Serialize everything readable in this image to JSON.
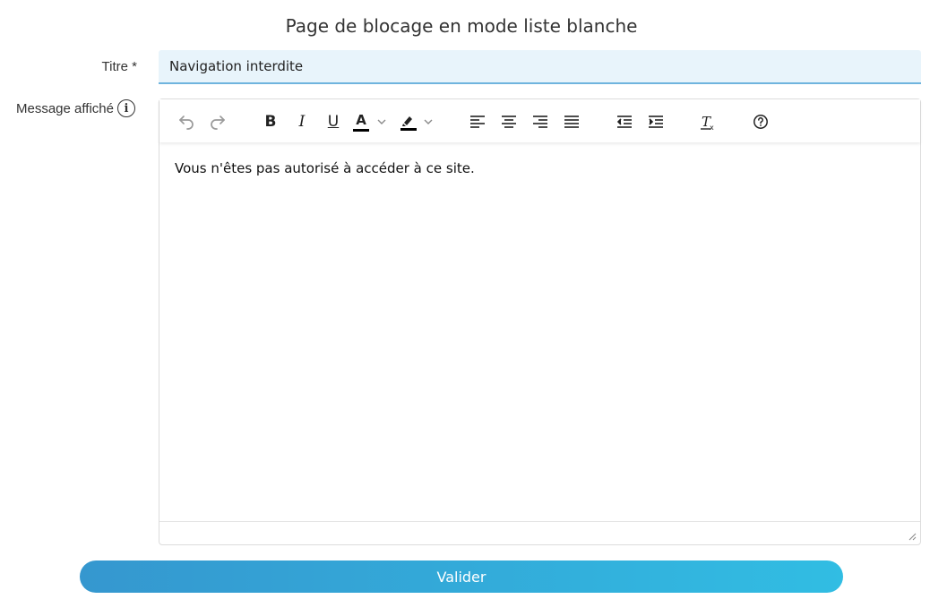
{
  "page": {
    "title": "Page de blocage en mode liste blanche"
  },
  "form": {
    "title_label": "Titre *",
    "title_value": "Navigation interdite",
    "message_label": "Message affiché",
    "message_content": "Vous n'êtes pas autorisé à accéder à ce site."
  },
  "toolbar": {
    "buttons": [
      {
        "name": "undo",
        "icon": "undo-icon",
        "disabled": true
      },
      {
        "name": "redo",
        "icon": "redo-icon",
        "disabled": true
      },
      {
        "name": "bold",
        "icon": "bold-icon",
        "glyph": "B"
      },
      {
        "name": "italic",
        "icon": "italic-icon",
        "glyph": "I"
      },
      {
        "name": "underline",
        "icon": "underline-icon",
        "glyph": "U"
      },
      {
        "name": "text-color",
        "icon": "text-color-icon",
        "glyph": "A"
      },
      {
        "name": "highlight-color",
        "icon": "highlight-icon"
      },
      {
        "name": "align-left",
        "icon": "align-left-icon"
      },
      {
        "name": "align-center",
        "icon": "align-center-icon"
      },
      {
        "name": "align-right",
        "icon": "align-right-icon"
      },
      {
        "name": "justify",
        "icon": "justify-icon"
      },
      {
        "name": "outdent",
        "icon": "outdent-icon"
      },
      {
        "name": "indent",
        "icon": "indent-icon"
      },
      {
        "name": "clear-format",
        "icon": "clear-format-icon"
      },
      {
        "name": "help",
        "icon": "help-icon"
      }
    ]
  },
  "actions": {
    "submit_label": "Valider"
  },
  "colors": {
    "accent": "#31bde3",
    "accent_dark": "#3597cf",
    "input_bg": "#e8f4fb",
    "input_border": "#6fb4de"
  }
}
